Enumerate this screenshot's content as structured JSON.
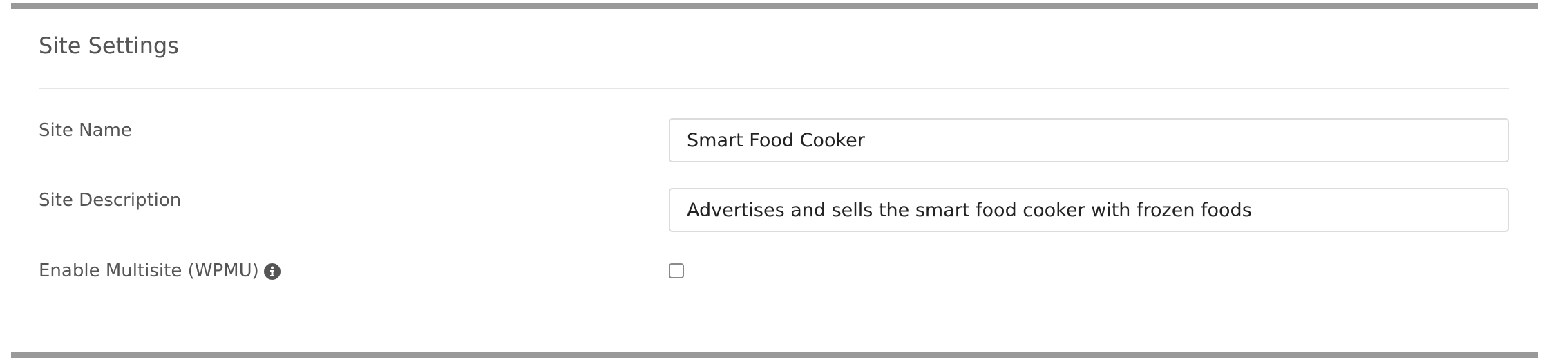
{
  "panel": {
    "title": "Site Settings"
  },
  "fields": {
    "site_name": {
      "label": "Site Name",
      "value": "Smart Food Cooker"
    },
    "site_description": {
      "label": "Site Description",
      "value": "Advertises and sells the smart food cooker with frozen foods"
    },
    "multisite": {
      "label": "Enable Multisite (WPMU)",
      "checked": false,
      "icon": "info-icon"
    }
  },
  "colors": {
    "bar": "#999999",
    "label_text": "#555555",
    "input_text": "#222222",
    "input_border": "#dcdcdc",
    "info_icon": "#555555"
  }
}
